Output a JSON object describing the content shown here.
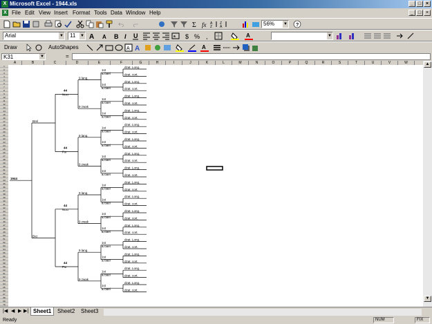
{
  "window": {
    "title": "Microsoft Excel - 1944.xls",
    "min": "_",
    "restore": "□",
    "close": "×"
  },
  "menu": [
    "File",
    "Edit",
    "View",
    "Insert",
    "Format",
    "Tools",
    "Data",
    "Window",
    "Help"
  ],
  "toolbar": {
    "zoom": "56%",
    "font": "Arial",
    "size": "11",
    "draw": "Draw",
    "autoshapes": "AutoShapes"
  },
  "formula": {
    "namebox": "K31",
    "eq": "="
  },
  "columns": [
    "A",
    "B",
    "C",
    "D",
    "E",
    "F",
    "G",
    "H",
    "I",
    "J",
    "K",
    "L",
    "M",
    "N",
    "O",
    "P",
    "Q",
    "R",
    "S",
    "T",
    "U",
    "V",
    "W"
  ],
  "bracket": {
    "root": "1944",
    "l1": [
      "Brel",
      "Bvz"
    ],
    "l2": "44",
    "l2tags": [
      "Nocr",
      "Fsr"
    ],
    "l3": [
      "9 lang.",
      "9 zwak"
    ],
    "l4": [
      "1st",
      "& bael"
    ],
    "l5": [
      "dzat. Long.",
      "dzat. cort."
    ]
  },
  "tabs": [
    "Sheet1",
    "Sheet2",
    "Sheet3"
  ],
  "status": {
    "ready": "Ready",
    "num": "NUM",
    "fix": "FIX"
  }
}
